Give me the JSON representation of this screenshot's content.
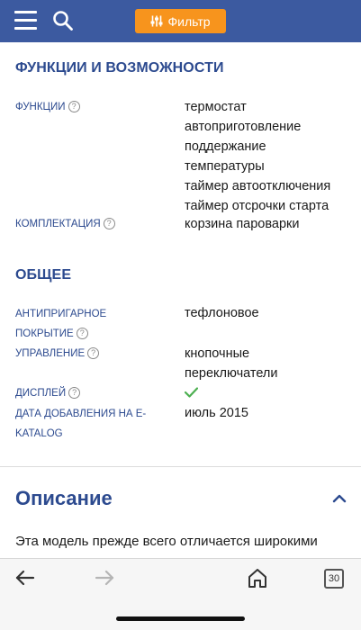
{
  "header": {
    "menu_icon": "hamburger-icon",
    "search_icon": "search-icon",
    "filter_icon": "sliders-icon",
    "filter_label": "Фильтр"
  },
  "features_section": {
    "title": "ФУНКЦИИ И ВОЗМОЖНОСТИ",
    "rows": [
      {
        "label": "ФУНКЦИИ",
        "help": "?",
        "values": [
          "термостат",
          "автоприготовление",
          "поддержание",
          "температуры",
          "таймер автоотключения",
          "таймер отсрочки старта"
        ]
      },
      {
        "label": "КОМПЛЕКТАЦИЯ",
        "help": "?",
        "values": [
          "корзина пароварки"
        ]
      }
    ]
  },
  "general_section": {
    "title": "ОБЩЕЕ",
    "rows": [
      {
        "label_lines": [
          "АНТИПРИГАРНОЕ",
          "ПОКРЫТИЕ"
        ],
        "help": "?",
        "values": [
          "тефлоновое"
        ]
      },
      {
        "label_lines": [
          "УПРАВЛЕНИЕ"
        ],
        "help": "?",
        "values": [
          "кнопочные",
          "переключатели"
        ]
      },
      {
        "label_lines": [
          "ДИСПЛЕЙ"
        ],
        "help": "?",
        "value_icon": "checkmark-icon",
        "value_color": "#4caf50"
      },
      {
        "label_lines": [
          "ДАТА ДОБАВЛЕНИЯ НА E-",
          "KATALOG"
        ],
        "values": [
          "июль 2015"
        ]
      }
    ]
  },
  "description": {
    "title": "Описание",
    "toggle_icon": "chevron-up-icon",
    "text": "Эта модель прежде всего отличается широкими"
  },
  "browser_nav": {
    "back_icon": "arrow-left-icon",
    "forward_icon": "arrow-right-icon",
    "home_icon": "home-icon",
    "tabs_count": "30"
  },
  "colors": {
    "header_bg": "#3c5aa0",
    "accent": "#f7941d",
    "heading": "#2c4a8f",
    "check": "#4caf50"
  }
}
